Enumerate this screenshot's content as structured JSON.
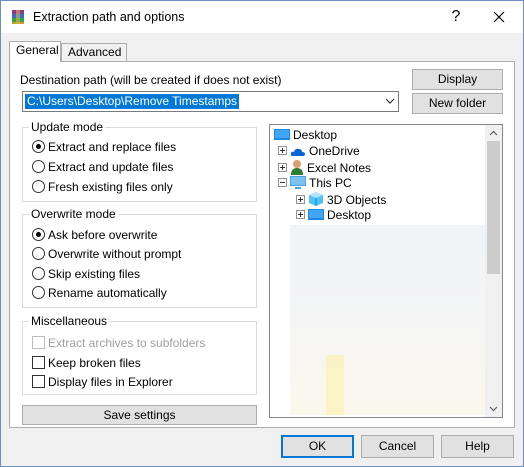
{
  "window": {
    "title": "Extraction path and options",
    "help_glyph": "?"
  },
  "tabs": [
    {
      "label": "General",
      "active": true
    },
    {
      "label": "Advanced",
      "active": false
    }
  ],
  "destination": {
    "label": "Destination path (will be created if does not exist)",
    "value": "C:\\Users\\Desktop\\Remove Timestamps"
  },
  "buttons": {
    "display": "Display",
    "new_folder": "New folder",
    "save_settings": "Save settings"
  },
  "update_mode": {
    "title": "Update mode",
    "options": [
      {
        "label": "Extract and replace files",
        "checked": true
      },
      {
        "label": "Extract and update files",
        "checked": false
      },
      {
        "label": "Fresh existing files only",
        "checked": false
      }
    ]
  },
  "overwrite_mode": {
    "title": "Overwrite mode",
    "options": [
      {
        "label": "Ask before overwrite",
        "checked": true
      },
      {
        "label": "Overwrite without prompt",
        "checked": false
      },
      {
        "label": "Skip existing files",
        "checked": false
      },
      {
        "label": "Rename automatically",
        "checked": false
      }
    ]
  },
  "misc": {
    "title": "Miscellaneous",
    "options": [
      {
        "label": "Extract archives to subfolders",
        "checked": false,
        "disabled": true
      },
      {
        "label": "Keep broken files",
        "checked": false,
        "disabled": false
      },
      {
        "label": "Display files in Explorer",
        "checked": false,
        "disabled": false
      }
    ]
  },
  "tree": {
    "items": [
      {
        "label": "Desktop",
        "icon": "desktop-icon"
      },
      {
        "label": "OneDrive",
        "icon": "onedrive-icon",
        "expander": "plus"
      },
      {
        "label": "Excel Notes",
        "icon": "user-icon",
        "expander": "plus"
      },
      {
        "label": "This PC",
        "icon": "computer-icon",
        "expander": "minus"
      },
      {
        "label": "3D Objects",
        "icon": "3d-objects-icon",
        "expander": "plus"
      },
      {
        "label": "Desktop",
        "icon": "desktop-icon",
        "expander": "plus"
      }
    ]
  },
  "footer": {
    "ok": "OK",
    "cancel": "Cancel",
    "help": "Help"
  },
  "colors": {
    "accent": "#0078d7",
    "selection": "#0078d7",
    "folder": "#1e90ff"
  }
}
